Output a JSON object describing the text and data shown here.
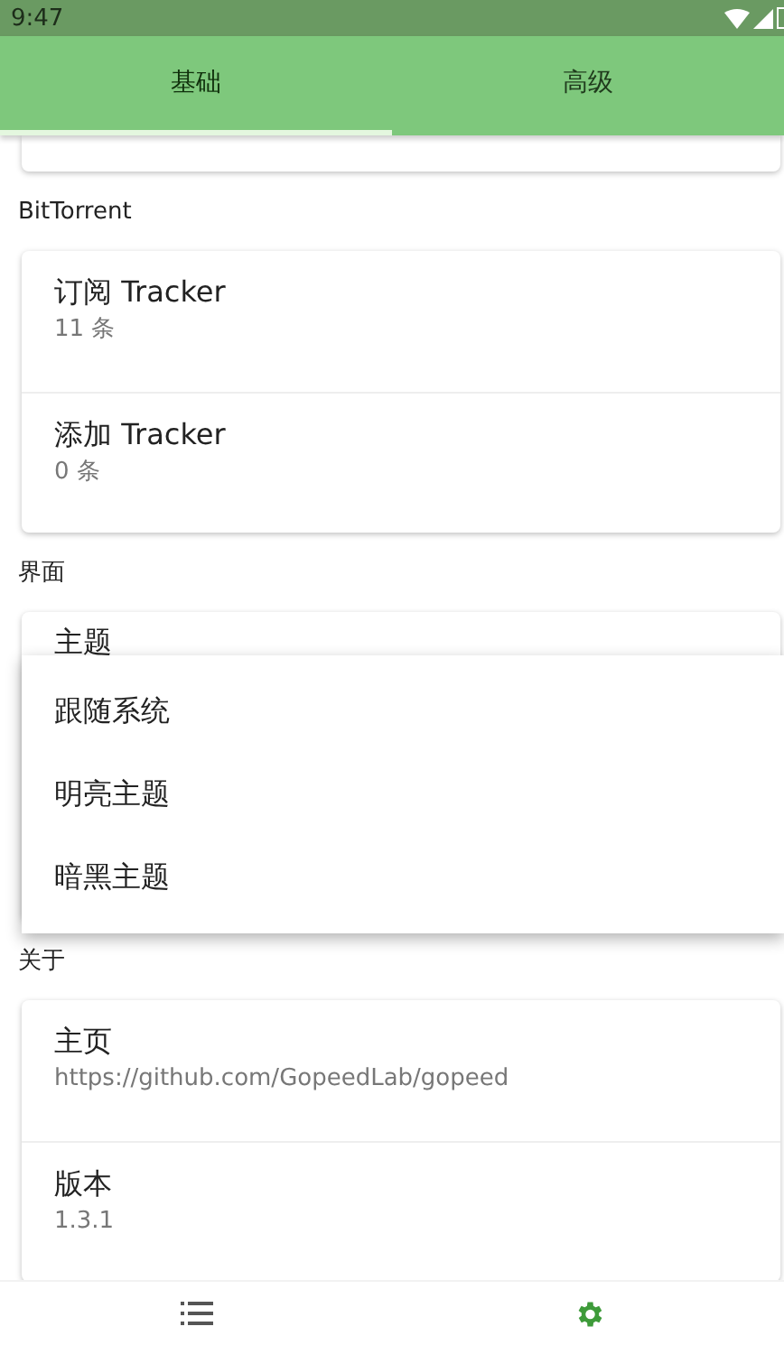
{
  "status_bar": {
    "time": "9:47"
  },
  "tabs": [
    {
      "label": "基础",
      "selected": true
    },
    {
      "label": "高级",
      "selected": false
    }
  ],
  "sections": [
    {
      "title": "BitTorrent",
      "kind": "list",
      "items": [
        {
          "title": "订阅 Tracker",
          "subtitle": "11 条"
        },
        {
          "title": "添加 Tracker",
          "subtitle": "0 条"
        }
      ]
    },
    {
      "title": "界面",
      "kind": "theme",
      "items": [
        {
          "title": "主题"
        }
      ]
    },
    {
      "title": "关于",
      "kind": "list",
      "items": [
        {
          "title": "主页",
          "subtitle": "https://github.com/GopeedLab/gopeed"
        },
        {
          "title": "版本",
          "subtitle": "1.3.1"
        }
      ]
    }
  ],
  "theme_menu": {
    "options": [
      {
        "label": "跟随系统"
      },
      {
        "label": "明亮主题"
      },
      {
        "label": "暗黑主题"
      }
    ]
  },
  "bottom_nav": [
    {
      "kind": "list",
      "selected": false
    },
    {
      "kind": "settings",
      "selected": true
    }
  ]
}
